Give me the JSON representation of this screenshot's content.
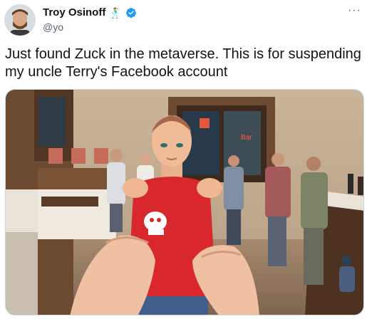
{
  "author": {
    "name": "Troy Osinoff",
    "emoji": "🕺",
    "handle": "@yo",
    "verified": true
  },
  "menu": {
    "more_label": "···"
  },
  "tweet": {
    "text": "Just found Zuck in the metaverse. This is for suspending my uncle Terry's Facebook account"
  },
  "media": {
    "shirt_text": "",
    "sign_text": "Bar"
  },
  "colors": {
    "verified_blue": "#1d9bf0",
    "handle_gray": "#536471",
    "shirt_red": "#d9272e"
  }
}
